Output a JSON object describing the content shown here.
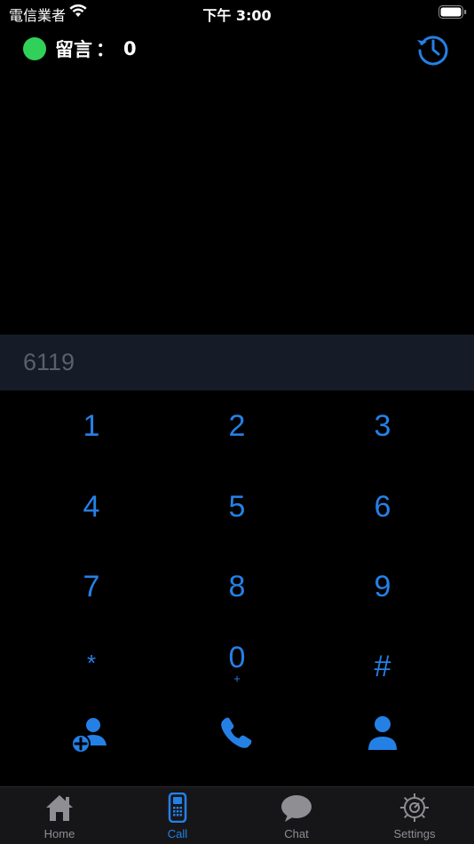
{
  "status_bar": {
    "carrier": "電信業者",
    "time": "下午 3:00"
  },
  "voicemail": {
    "label": "留言",
    "colon": "：",
    "count": "0",
    "indicator_color": "#30d158"
  },
  "dialer": {
    "number": "6119",
    "keys": [
      {
        "digit": "1",
        "sub": ""
      },
      {
        "digit": "2",
        "sub": ""
      },
      {
        "digit": "3",
        "sub": ""
      },
      {
        "digit": "4",
        "sub": ""
      },
      {
        "digit": "5",
        "sub": ""
      },
      {
        "digit": "6",
        "sub": ""
      },
      {
        "digit": "7",
        "sub": ""
      },
      {
        "digit": "8",
        "sub": ""
      },
      {
        "digit": "9",
        "sub": ""
      },
      {
        "digit": "*",
        "sub": ""
      },
      {
        "digit": "0",
        "sub": "+"
      },
      {
        "digit": "#",
        "sub": ""
      }
    ],
    "actions": [
      "add-contact-icon",
      "phone-icon",
      "contact-icon"
    ]
  },
  "tabs": [
    {
      "label": "Home",
      "icon": "home-icon",
      "active": false
    },
    {
      "label": "Call",
      "icon": "phone-device-icon",
      "active": true
    },
    {
      "label": "Chat",
      "icon": "chat-bubble-icon",
      "active": false
    },
    {
      "label": "Settings",
      "icon": "gear-icon",
      "active": false
    }
  ],
  "colors": {
    "accent": "#2580e6",
    "background": "#000000",
    "display_bg": "#151b27",
    "tab_bg": "#161618"
  }
}
